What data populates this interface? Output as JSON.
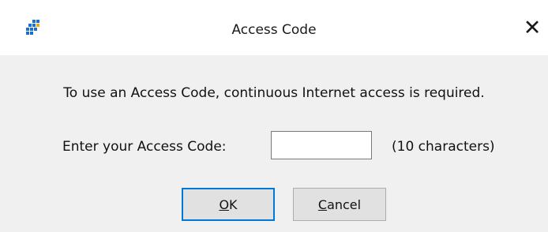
{
  "dialog": {
    "title": "Access Code",
    "icon": "app-grid-icon",
    "close_icon": "close-icon"
  },
  "content": {
    "message": "To use an Access Code, continuous Internet access is required.",
    "code_label": "Enter your Access Code:",
    "code_value": "",
    "code_hint": "(10 characters)"
  },
  "buttons": {
    "ok": {
      "mnemonic": "O",
      "rest": "K"
    },
    "cancel": {
      "mnemonic": "C",
      "rest": "ancel"
    }
  },
  "colors": {
    "accent": "#0078d7",
    "icon_blue": "#1a6fd1",
    "dialog_bg": "#f0f0f0"
  }
}
